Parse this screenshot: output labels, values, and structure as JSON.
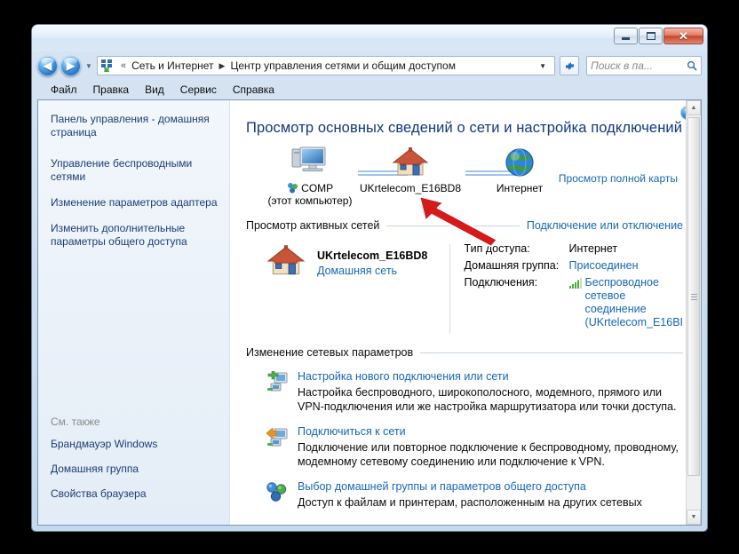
{
  "window": {
    "controls": {
      "minimize": "–",
      "maximize": "❐",
      "close": "✕"
    }
  },
  "addressbar": {
    "back_label": "◀",
    "forward_label": "▶",
    "history_caret": "▾",
    "crumb_overflow": "«",
    "crumb_network": "Сеть и Интернет",
    "crumb_separator": "▶",
    "crumb_current": "Центр управления сетями и общим доступом",
    "dropdown_caret": "▾",
    "refresh_label": "↯",
    "search_placeholder": "Поиск в па...",
    "search_value": "",
    "search_icon": "🔍"
  },
  "menubar": {
    "items": [
      {
        "label": "Файл"
      },
      {
        "label": "Правка"
      },
      {
        "label": "Вид"
      },
      {
        "label": "Сервис"
      },
      {
        "label": "Справка"
      }
    ]
  },
  "navpane": {
    "items": [
      {
        "label": "Панель управления - домашняя страница"
      },
      {
        "label": "Управление беспроводными сетями"
      },
      {
        "label": "Изменение параметров адаптера"
      },
      {
        "label": "Изменить дополнительные параметры общего доступа"
      }
    ],
    "see_also_label": "См. также",
    "see_also_items": [
      {
        "label": "Брандмауэр Windows"
      },
      {
        "label": "Домашняя группа"
      },
      {
        "label": "Свойства браузера"
      }
    ]
  },
  "content": {
    "help_label": "?",
    "page_title": "Просмотр основных сведений о сети и настройка подключений",
    "map": {
      "full_map_link": "Просмотр полной карты",
      "nodes": [
        {
          "label": "COMP",
          "sublabel": "(этот компьютер)",
          "icon": "computer-icon"
        },
        {
          "label": "UKrtelecom_E16BD8",
          "sublabel": "",
          "icon": "home-network-icon"
        },
        {
          "label": "Интернет",
          "sublabel": "",
          "icon": "globe-icon"
        }
      ]
    },
    "active_networks": {
      "section_title": "Просмотр активных сетей",
      "section_action": "Подключение или отключение",
      "network_name": "UKrtelecom_E16BD8",
      "network_type": "Домашняя сеть",
      "details": [
        {
          "key": "Тип доступа:",
          "value": "Интернет",
          "is_link": false
        },
        {
          "key": "Домашняя группа:",
          "value": "Присоединен",
          "is_link": true
        },
        {
          "key": "Подключения:",
          "value": "Беспроводное сетевое соединение (UKrtelecom_E16BI",
          "is_link": true
        }
      ]
    },
    "change_settings": {
      "section_title": "Изменение сетевых параметров",
      "items": [
        {
          "icon": "new-connection-icon",
          "title": "Настройка нового подключения или сети",
          "desc": "Настройка беспроводного, широкополосного, модемного, прямого или VPN-подключения или же настройка маршрутизатора или точки доступа."
        },
        {
          "icon": "connect-network-icon",
          "title": "Подключиться к сети",
          "desc": "Подключение или повторное подключение к беспроводному, проводному, модемному сетевому соединению или подключение к VPN."
        },
        {
          "icon": "homegroup-icon",
          "title": "Выбор домашней группы и параметров общего доступа",
          "desc": "Доступ к файлам и принтерам, расположенным на других сетевых"
        }
      ]
    }
  },
  "scrollbar": {
    "up_arrow": "▲",
    "down_arrow": "▼"
  },
  "annotation": {
    "type": "red-arrow",
    "color": "#d41a1a"
  },
  "colors": {
    "link": "#1767b2",
    "title": "#11387e",
    "nav_link": "#1b3d73",
    "accent_red": "#d41a1a"
  }
}
